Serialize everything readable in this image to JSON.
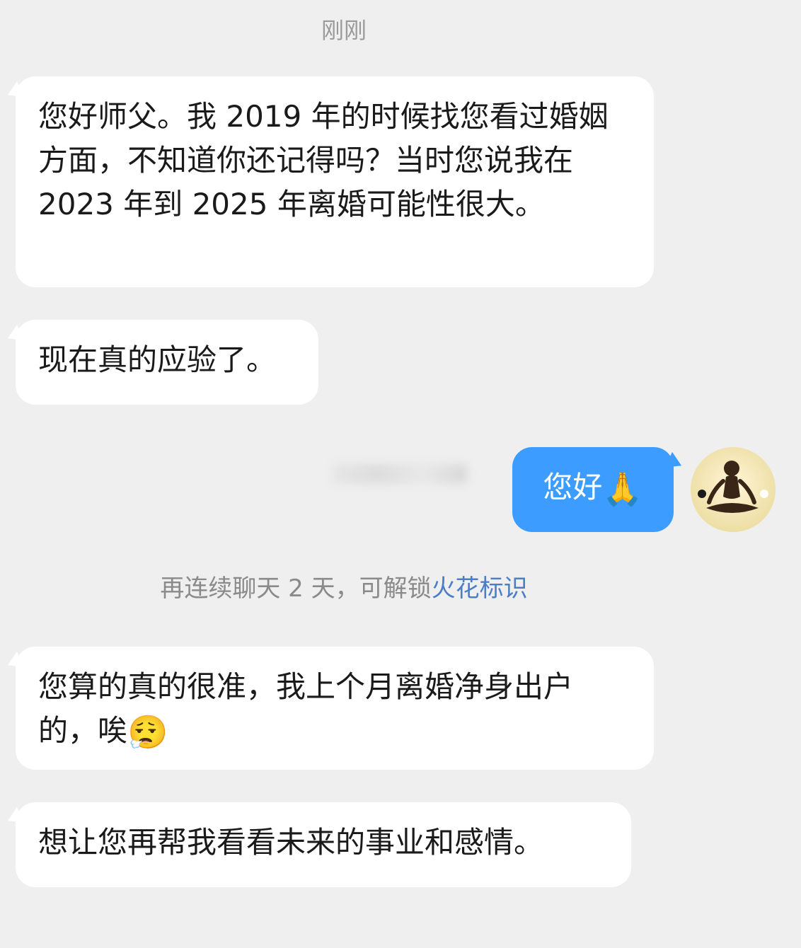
{
  "timestamp": "刚刚",
  "messages": [
    {
      "side": "incoming",
      "text": "您好师父。我 2019 年的时候找您看过婚姻方面，不知道你还记得吗？当时您说我在 2023 年到 2025 年离婚可能性很大。"
    },
    {
      "side": "incoming",
      "text": "现在真的应验了。"
    },
    {
      "side": "outgoing",
      "text": "您好",
      "emoji": "🙏"
    },
    {
      "side": "incoming",
      "text": "您算的真的很准，我上个月离婚净身出户的，唉",
      "emoji": "😮‍💨"
    },
    {
      "side": "incoming",
      "text": "想让您再帮我看看未来的事业和感情。"
    }
  ],
  "system_note": {
    "text": "再连续聊天 2 天，可解锁",
    "link": "火花标识"
  },
  "colors": {
    "background": "#efefef",
    "incoming_bubble": "#ffffff",
    "outgoing_bubble": "#3c9cff",
    "link": "#4a7fc8"
  },
  "icons": {
    "avatar": "meditating-figure-avatar"
  }
}
